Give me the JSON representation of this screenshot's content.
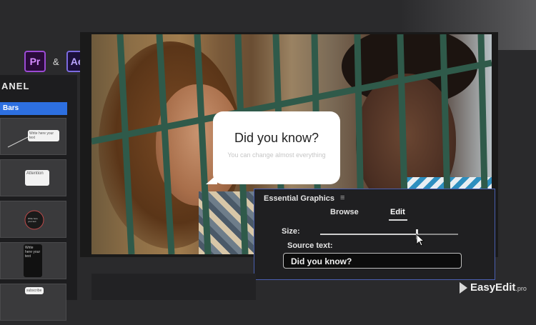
{
  "apps": {
    "pr_label": "Pr",
    "amp": "&",
    "ae_label": "Ae"
  },
  "left_panel": {
    "title": "ANEL",
    "active_tab": "Bars",
    "templates": [
      {
        "preview_text": "Write here your text"
      },
      {
        "preview_text": "Attention"
      },
      {
        "preview_text": "Write here your text"
      },
      {
        "preview_text": "Write here your text"
      },
      {
        "preview_text": "subscribe"
      }
    ]
  },
  "bubble": {
    "title": "Did you know?",
    "subtitle": "You can change almost everything"
  },
  "essential_graphics": {
    "title": "Essential Graphics",
    "menu_icon": "hamburger-icon",
    "tabs": [
      "Browse",
      "Edit"
    ],
    "active_tab": "Edit",
    "size_label": "Size:",
    "size_value": 0.7,
    "source_label": "Source text:",
    "source_value": "Did you know?"
  },
  "watermark": {
    "brand": "EasyEdit",
    "suffix": ".pro"
  },
  "colors": {
    "accent": "#2d6fe0",
    "panel_border": "#4a5fb0",
    "bar_green": "#2f5a4a"
  }
}
